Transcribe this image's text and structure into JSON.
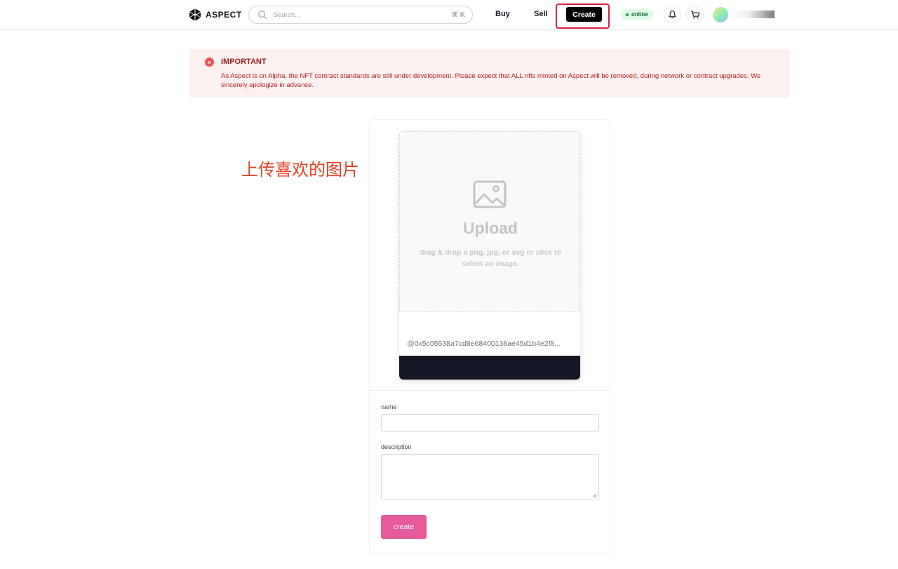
{
  "header": {
    "logo_text": "ASPECT",
    "search": {
      "placeholder": "Search...",
      "shortcut": "⌘ K"
    },
    "nav": {
      "buy": "Buy",
      "sell": "Sell",
      "create": "Create"
    },
    "status": "online"
  },
  "alert": {
    "title": "IMPORTANT",
    "body": "As Aspect is on Alpha, the NFT contract standards are still under development. Please expect that ALL nfts minted on Aspect will be removed, during network or contract upgrades. We sincerely apologize in advance."
  },
  "annotation": "上传喜欢的图片",
  "create_form": {
    "upload_title": "Upload",
    "upload_hint": "drag & drop a png, jpg, or svg or click to select an image.",
    "owner_address": "@0x5c05538a7cd8e68400136ae45d1b4e2f8...",
    "name_label": "name",
    "name_value": "",
    "description_label": "description",
    "description_value": "",
    "submit_label": "create"
  },
  "colors": {
    "brand_pink": "#e55a9a",
    "alert_red": "#9b1c1c",
    "annotation_red": "#e53e21",
    "highlight_red": "#e11d48"
  }
}
